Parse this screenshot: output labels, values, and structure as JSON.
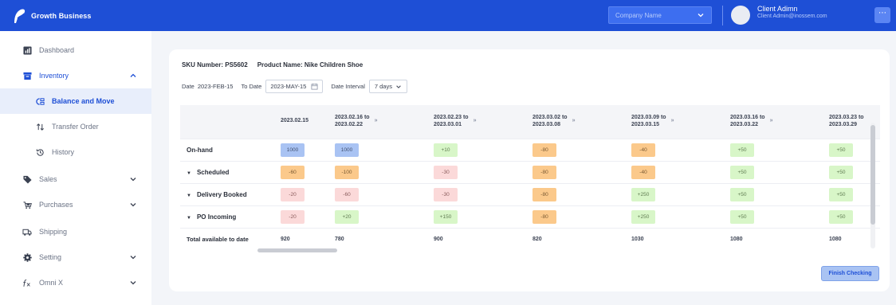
{
  "brand": {
    "name": "Growth Business"
  },
  "header": {
    "company_placeholder": "Company Name",
    "user_name": "Client Adimn",
    "user_email": "Client Admin@inossem.com",
    "menu_glyph": "⋯"
  },
  "sidebar": {
    "items": [
      {
        "label": "Dashboard",
        "icon": "chart-icon"
      },
      {
        "label": "Inventory",
        "icon": "inventory-icon",
        "expanded": true
      },
      {
        "label": "Balance and Move",
        "icon": "balance-icon",
        "active": true
      },
      {
        "label": "Transfer Order",
        "icon": "transfer-icon"
      },
      {
        "label": "History",
        "icon": "history-icon"
      },
      {
        "label": "Sales",
        "icon": "tag-icon"
      },
      {
        "label": "Purchases",
        "icon": "purchases-icon"
      },
      {
        "label": "Shipping",
        "icon": "truck-icon"
      },
      {
        "label": "Setting",
        "icon": "gear-icon"
      },
      {
        "label": "Omni X",
        "icon": "function-icon"
      }
    ]
  },
  "product": {
    "sku_label": "SKU Number: PS5602",
    "name_label": "Product Name: Nike Children Shoe"
  },
  "filters": {
    "date_label": "Date",
    "date_from": "2023-FEB-15",
    "to_label": "To Date",
    "date_to": "2023-MAY-15",
    "interval_label": "Date Interval",
    "interval_value": "7 days"
  },
  "table": {
    "arrow_glyph": "»",
    "columns": [
      {
        "line1": "2023.02.15",
        "line2": ""
      },
      {
        "line1": "2023.02.16 to",
        "line2": "2023.02.22"
      },
      {
        "line1": "2023.02.23 to",
        "line2": "2023.03.01"
      },
      {
        "line1": "2023.03.02 to",
        "line2": "2023.03.08"
      },
      {
        "line1": "2023.03.09 to",
        "line2": "2023.03.15"
      },
      {
        "line1": "2023.03.16 to",
        "line2": "2023.03.22"
      },
      {
        "line1": "2023.03.23 to",
        "line2": "2023.03.29"
      }
    ],
    "rows": [
      {
        "label": "On-hand",
        "expandable": false,
        "cells": [
          "1000",
          "1000",
          "+10",
          "-80",
          "-40",
          "+50",
          "+50"
        ]
      },
      {
        "label": "Scheduled",
        "expandable": true,
        "cells": [
          "-60",
          "-100",
          "-30",
          "-80",
          "-40",
          "+50",
          "+50"
        ]
      },
      {
        "label": "Delivery Booked",
        "expandable": true,
        "cells": [
          "-20",
          "-60",
          "-30",
          "-80",
          "+250",
          "+50",
          "+50"
        ]
      },
      {
        "label": "PO Incoming",
        "expandable": true,
        "cells": [
          "-20",
          "+20",
          "+150",
          "-80",
          "+250",
          "+50",
          "+50"
        ]
      }
    ],
    "cell_colors": [
      [
        "blue",
        "blue",
        "green",
        "orange",
        "orange",
        "green",
        "green"
      ],
      [
        "orange",
        "orange",
        "pink",
        "orange",
        "orange",
        "green",
        "green"
      ],
      [
        "pink",
        "pink",
        "pink",
        "orange",
        "green",
        "green",
        "green"
      ],
      [
        "pink",
        "green",
        "green",
        "orange",
        "green",
        "green",
        "green"
      ]
    ],
    "total": {
      "label": "Total available to date",
      "values": [
        "920",
        "780",
        "900",
        "820",
        "1030",
        "1080",
        "1080"
      ]
    }
  },
  "actions": {
    "finish_label": "Finish Checking"
  },
  "colors": {
    "primary": "#1e4fd6",
    "pill_blue": "#a9c3f3",
    "pill_green": "#d8f6c8",
    "pill_orange": "#fbc98b",
    "pill_pink": "#fbd9d9"
  }
}
